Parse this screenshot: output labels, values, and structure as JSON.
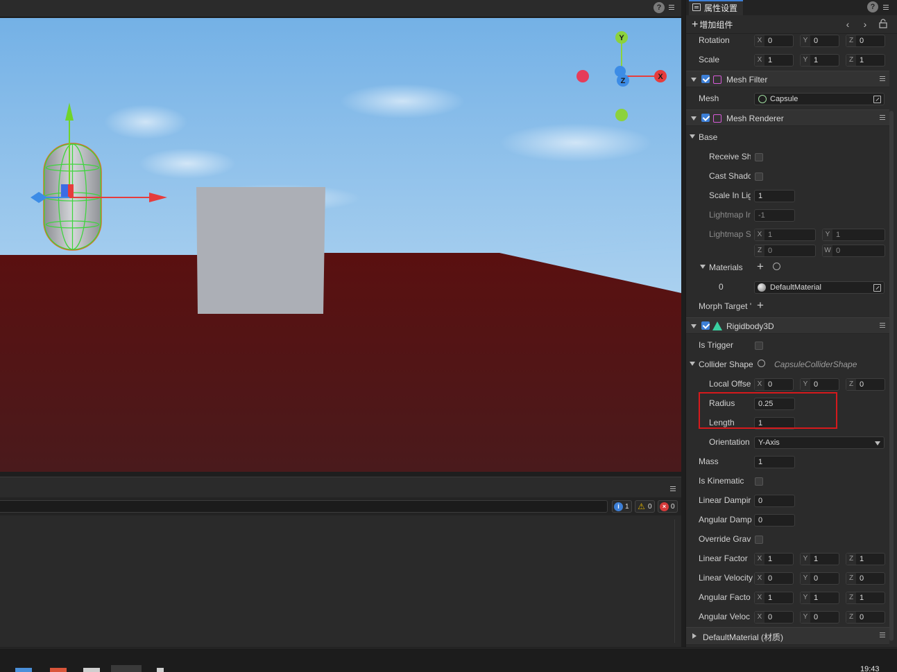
{
  "inspector": {
    "tab_title": "属性设置",
    "add_component": "增加组件",
    "transform": {
      "rotation": {
        "label": "Rotation",
        "x": "0",
        "y": "0",
        "z": "0"
      },
      "scale": {
        "label": "Scale",
        "x": "1",
        "y": "1",
        "z": "1"
      }
    },
    "mesh_filter": {
      "title": "Mesh Filter",
      "mesh_label": "Mesh",
      "mesh_value": "Capsule"
    },
    "mesh_renderer": {
      "title": "Mesh Renderer",
      "base_label": "Base",
      "receive_shadow": "Receive Sh",
      "cast_shadow": "Cast Shadc",
      "scale_in_lightmap": {
        "label": "Scale In Lig",
        "value": "1"
      },
      "lightmap_index": {
        "label": "Lightmap Ir",
        "value": "-1"
      },
      "lightmap_scale": {
        "label": "Lightmap S",
        "x": "1",
        "y": "1",
        "z": "0",
        "w": "0"
      },
      "materials_label": "Materials",
      "material_index": "0",
      "material_value": "DefaultMaterial",
      "morph_target": "Morph Target '"
    },
    "rigidbody": {
      "title": "Rigidbody3D",
      "is_trigger": "Is Trigger",
      "collider_shape": {
        "label": "Collider Shape",
        "value": "CapsuleColliderShape"
      },
      "local_offset": {
        "label": "Local Offse",
        "x": "0",
        "y": "0",
        "z": "0"
      },
      "radius": {
        "label": "Radius",
        "value": "0.25"
      },
      "length": {
        "label": "Length",
        "value": "1"
      },
      "orientation": {
        "label": "Orientation",
        "value": "Y-Axis"
      },
      "mass": {
        "label": "Mass",
        "value": "1"
      },
      "is_kinematic": "Is Kinematic",
      "linear_damping": {
        "label": "Linear Dampir",
        "value": "0"
      },
      "angular_damping": {
        "label": "Angular Damp",
        "value": "0"
      },
      "override_gravity": "Override Grav",
      "linear_factor": {
        "label": "Linear Factor",
        "x": "1",
        "y": "1",
        "z": "1"
      },
      "linear_velocity": {
        "label": "Linear Velocity",
        "x": "0",
        "y": "0",
        "z": "0"
      },
      "angular_factor": {
        "label": "Angular Facto",
        "x": "1",
        "y": "1",
        "z": "1"
      },
      "angular_velocity": {
        "label": "Angular Veloc",
        "x": "0",
        "y": "0",
        "z": "0"
      }
    },
    "default_material_section": "DefaultMaterial (材质)"
  },
  "axes": {
    "x": "X",
    "y": "Y",
    "z": "Z",
    "w": "W"
  },
  "console": {
    "info_count": "1",
    "warning_count": "0",
    "error_count": "0"
  },
  "gizmo": {
    "x": "X",
    "y": "Y",
    "z": "Z"
  },
  "taskbar": {
    "clock": "19:43"
  },
  "colors": {
    "accent": "#3d7fd6",
    "highlight": "#d7191c",
    "sky_top": "#74b1e6",
    "ground": "#5a1414"
  }
}
